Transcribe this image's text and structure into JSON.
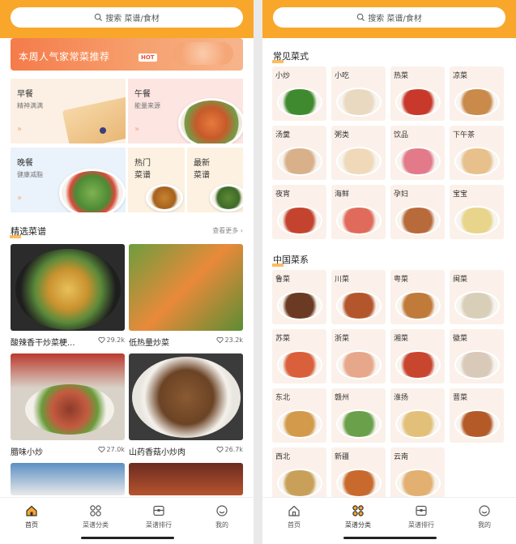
{
  "left": {
    "search_text": "搜索 菜谱/食材",
    "banner": {
      "title": "本周人气家常菜推荐",
      "badge": "HOT"
    },
    "tiles": {
      "breakfast": {
        "title": "早餐",
        "subtitle": "精神满满"
      },
      "lunch": {
        "title": "午餐",
        "subtitle": "能量来源"
      },
      "dinner": {
        "title": "晚餐",
        "subtitle": "健康减脂"
      },
      "hot": {
        "line1": "热门",
        "line2": "菜谱"
      },
      "newest": {
        "line1": "最新",
        "line2": "菜谱"
      }
    },
    "section": {
      "title": "精选菜谱",
      "more": "查看更多 ›"
    },
    "recipes": [
      {
        "name": "酸辣香干炒菜梗...",
        "likes": "29.2k"
      },
      {
        "name": "低热量炒菜",
        "likes": "23.2k"
      },
      {
        "name": "腊味小炒",
        "likes": "27.0k"
      },
      {
        "name": "山药香菇小炒肉",
        "likes": "26.7k"
      }
    ]
  },
  "tabs": [
    {
      "label": "首页",
      "icon": "home-icon"
    },
    {
      "label": "菜谱分类",
      "icon": "category-icon"
    },
    {
      "label": "菜谱排行",
      "icon": "ranking-icon"
    },
    {
      "label": "我的",
      "icon": "smile-icon"
    }
  ],
  "right": {
    "search_text": "搜索 菜谱/食材",
    "common_title": "常见菜式",
    "common": [
      "小炒",
      "小吃",
      "热菜",
      "凉菜",
      "汤羹",
      "粥类",
      "饮品",
      "下午茶",
      "夜宵",
      "海鲜",
      "孕妇",
      "宝宝"
    ],
    "cuisine_title": "中国菜系",
    "cuisines": [
      "鲁菜",
      "川菜",
      "粤菜",
      "闽菜",
      "苏菜",
      "浙菜",
      "湘菜",
      "徽菜",
      "东北",
      "赣州",
      "淮扬",
      "晋菜",
      "西北",
      "新疆",
      "云南"
    ]
  },
  "colors": {
    "accent": "#f9a72b",
    "banner": "#f57b4a"
  }
}
